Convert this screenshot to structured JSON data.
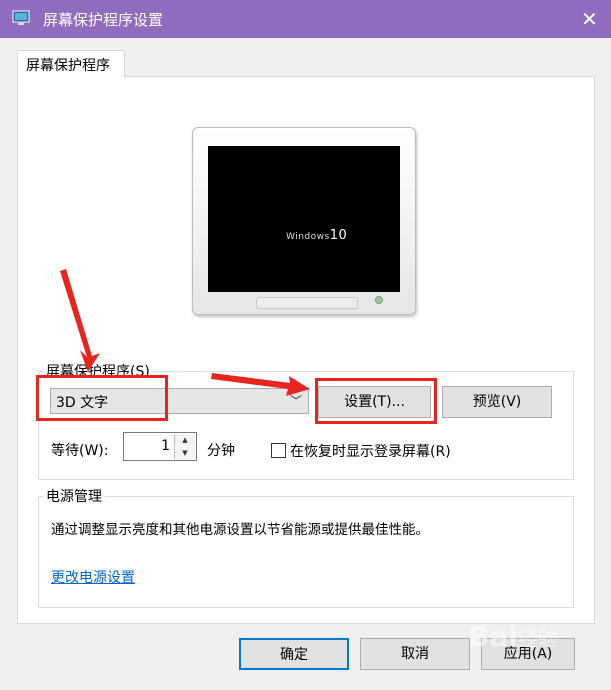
{
  "window": {
    "title": "屏幕保护程序设置",
    "close_glyph": "✕"
  },
  "tab": {
    "label": "屏幕保护程序"
  },
  "preview": {
    "screen_text_small": "Windows",
    "screen_text_big": "10"
  },
  "screensaver": {
    "group_label": "屏幕保护程序(S)",
    "selected": "3D 文字",
    "settings_button": "设置(T)...",
    "preview_button": "预览(V)",
    "wait_label": "等待(W):",
    "wait_value": "1",
    "wait_unit": "分钟",
    "resume_checkbox_label": "在恢复时显示登录屏幕(R)",
    "resume_checked": false
  },
  "power": {
    "group_label": "电源管理",
    "description": "通过调整显示亮度和其他电源设置以节省能源或提供最佳性能。",
    "link": "更改电源设置"
  },
  "footer": {
    "ok": "确定",
    "cancel": "取消",
    "apply": "应用(A)"
  },
  "watermark": {
    "text": "Bai",
    "suffix": "经验"
  },
  "colors": {
    "titlebar": "#8f6cbf",
    "annotation": "#e8241f",
    "link": "#0066cc",
    "focus": "#0078d7"
  }
}
